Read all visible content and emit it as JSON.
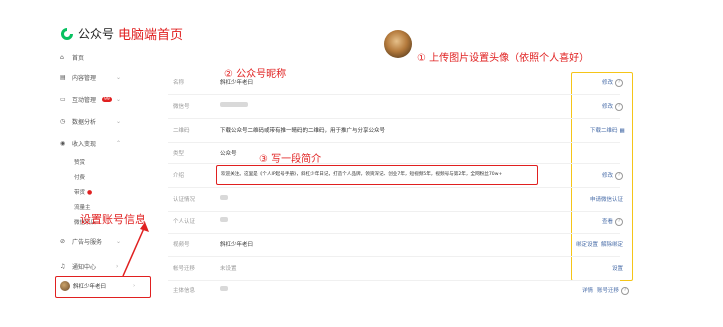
{
  "brand": {
    "name": "公众号",
    "annotation": "电脑端首页"
  },
  "sidebar": {
    "items": [
      {
        "label": "首页"
      },
      {
        "label": "内容管理"
      },
      {
        "label": "互动管理",
        "badge": "99"
      },
      {
        "label": "数据分析"
      },
      {
        "label": "收入变现"
      },
      {
        "label": "广告与服务"
      },
      {
        "label": "通知中心"
      }
    ],
    "subitems": [
      {
        "label": "赞赏"
      },
      {
        "label": "付费"
      },
      {
        "label": "带货"
      },
      {
        "label": "流量主"
      },
      {
        "label": "微信小店"
      }
    ],
    "user": {
      "name": "斜杠少年老曰"
    }
  },
  "annotations": {
    "avatar": "① 上传图片设置头像（依照个人喜好）",
    "nickname": "② 公众号昵称",
    "intro": "③ 写一段简介",
    "account": "设置账号信息"
  },
  "rows": [
    {
      "label": "名称",
      "value": "斜杠少年老曰",
      "action": "修改"
    },
    {
      "label": "微信号",
      "value": "",
      "action": "修改"
    },
    {
      "label": "二维码",
      "value": "下载公众号二维码或带有推一睛码的二维码，用于推广与分享公众号",
      "action": "下载二维码"
    },
    {
      "label": "类型",
      "value": "公众号",
      "action": ""
    },
    {
      "label": "介绍",
      "value": "欢迎关注。这里是《个人IP起号手册》，斜杠少年日记，打造个人品牌，领资深记、创业7年，短视频5年，视频号与第2年，全网粉丝70w+",
      "action": "修改"
    },
    {
      "label": "认证情况",
      "value": "",
      "action": "申请微信认证"
    },
    {
      "label": "个人认证",
      "value": "",
      "action": "查看"
    },
    {
      "label": "视频号",
      "value": "斜杠少年老曰",
      "action_left": "绑定设置",
      "action_right": "解除绑定"
    },
    {
      "label": "帐号迁移",
      "value": "未设置",
      "action": "设置"
    },
    {
      "label": "主体信息",
      "value": "",
      "action_left": "详情",
      "action_right": "账号迁移"
    }
  ]
}
